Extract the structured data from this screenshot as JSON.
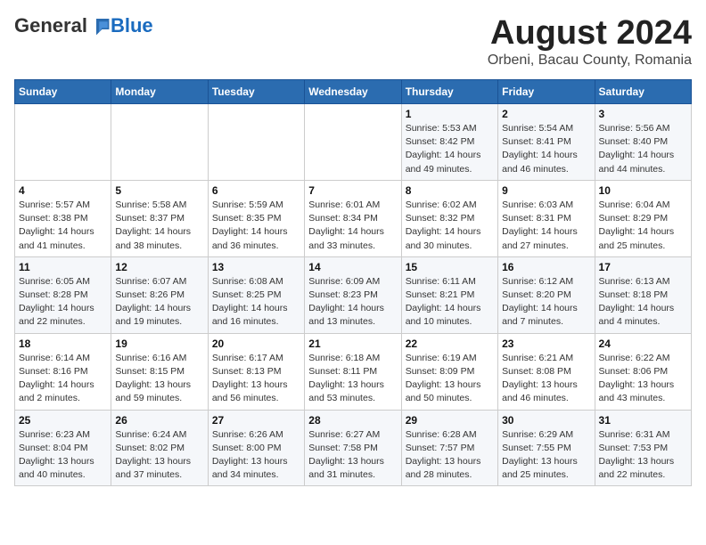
{
  "logo": {
    "general": "General",
    "blue": "Blue"
  },
  "title": {
    "month_year": "August 2024",
    "location": "Orbeni, Bacau County, Romania"
  },
  "weekdays": [
    "Sunday",
    "Monday",
    "Tuesday",
    "Wednesday",
    "Thursday",
    "Friday",
    "Saturday"
  ],
  "weeks": [
    [
      {
        "day": "",
        "info": ""
      },
      {
        "day": "",
        "info": ""
      },
      {
        "day": "",
        "info": ""
      },
      {
        "day": "",
        "info": ""
      },
      {
        "day": "1",
        "info": "Sunrise: 5:53 AM\nSunset: 8:42 PM\nDaylight: 14 hours\nand 49 minutes."
      },
      {
        "day": "2",
        "info": "Sunrise: 5:54 AM\nSunset: 8:41 PM\nDaylight: 14 hours\nand 46 minutes."
      },
      {
        "day": "3",
        "info": "Sunrise: 5:56 AM\nSunset: 8:40 PM\nDaylight: 14 hours\nand 44 minutes."
      }
    ],
    [
      {
        "day": "4",
        "info": "Sunrise: 5:57 AM\nSunset: 8:38 PM\nDaylight: 14 hours\nand 41 minutes."
      },
      {
        "day": "5",
        "info": "Sunrise: 5:58 AM\nSunset: 8:37 PM\nDaylight: 14 hours\nand 38 minutes."
      },
      {
        "day": "6",
        "info": "Sunrise: 5:59 AM\nSunset: 8:35 PM\nDaylight: 14 hours\nand 36 minutes."
      },
      {
        "day": "7",
        "info": "Sunrise: 6:01 AM\nSunset: 8:34 PM\nDaylight: 14 hours\nand 33 minutes."
      },
      {
        "day": "8",
        "info": "Sunrise: 6:02 AM\nSunset: 8:32 PM\nDaylight: 14 hours\nand 30 minutes."
      },
      {
        "day": "9",
        "info": "Sunrise: 6:03 AM\nSunset: 8:31 PM\nDaylight: 14 hours\nand 27 minutes."
      },
      {
        "day": "10",
        "info": "Sunrise: 6:04 AM\nSunset: 8:29 PM\nDaylight: 14 hours\nand 25 minutes."
      }
    ],
    [
      {
        "day": "11",
        "info": "Sunrise: 6:05 AM\nSunset: 8:28 PM\nDaylight: 14 hours\nand 22 minutes."
      },
      {
        "day": "12",
        "info": "Sunrise: 6:07 AM\nSunset: 8:26 PM\nDaylight: 14 hours\nand 19 minutes."
      },
      {
        "day": "13",
        "info": "Sunrise: 6:08 AM\nSunset: 8:25 PM\nDaylight: 14 hours\nand 16 minutes."
      },
      {
        "day": "14",
        "info": "Sunrise: 6:09 AM\nSunset: 8:23 PM\nDaylight: 14 hours\nand 13 minutes."
      },
      {
        "day": "15",
        "info": "Sunrise: 6:11 AM\nSunset: 8:21 PM\nDaylight: 14 hours\nand 10 minutes."
      },
      {
        "day": "16",
        "info": "Sunrise: 6:12 AM\nSunset: 8:20 PM\nDaylight: 14 hours\nand 7 minutes."
      },
      {
        "day": "17",
        "info": "Sunrise: 6:13 AM\nSunset: 8:18 PM\nDaylight: 14 hours\nand 4 minutes."
      }
    ],
    [
      {
        "day": "18",
        "info": "Sunrise: 6:14 AM\nSunset: 8:16 PM\nDaylight: 14 hours\nand 2 minutes."
      },
      {
        "day": "19",
        "info": "Sunrise: 6:16 AM\nSunset: 8:15 PM\nDaylight: 13 hours\nand 59 minutes."
      },
      {
        "day": "20",
        "info": "Sunrise: 6:17 AM\nSunset: 8:13 PM\nDaylight: 13 hours\nand 56 minutes."
      },
      {
        "day": "21",
        "info": "Sunrise: 6:18 AM\nSunset: 8:11 PM\nDaylight: 13 hours\nand 53 minutes."
      },
      {
        "day": "22",
        "info": "Sunrise: 6:19 AM\nSunset: 8:09 PM\nDaylight: 13 hours\nand 50 minutes."
      },
      {
        "day": "23",
        "info": "Sunrise: 6:21 AM\nSunset: 8:08 PM\nDaylight: 13 hours\nand 46 minutes."
      },
      {
        "day": "24",
        "info": "Sunrise: 6:22 AM\nSunset: 8:06 PM\nDaylight: 13 hours\nand 43 minutes."
      }
    ],
    [
      {
        "day": "25",
        "info": "Sunrise: 6:23 AM\nSunset: 8:04 PM\nDaylight: 13 hours\nand 40 minutes."
      },
      {
        "day": "26",
        "info": "Sunrise: 6:24 AM\nSunset: 8:02 PM\nDaylight: 13 hours\nand 37 minutes."
      },
      {
        "day": "27",
        "info": "Sunrise: 6:26 AM\nSunset: 8:00 PM\nDaylight: 13 hours\nand 34 minutes."
      },
      {
        "day": "28",
        "info": "Sunrise: 6:27 AM\nSunset: 7:58 PM\nDaylight: 13 hours\nand 31 minutes."
      },
      {
        "day": "29",
        "info": "Sunrise: 6:28 AM\nSunset: 7:57 PM\nDaylight: 13 hours\nand 28 minutes."
      },
      {
        "day": "30",
        "info": "Sunrise: 6:29 AM\nSunset: 7:55 PM\nDaylight: 13 hours\nand 25 minutes."
      },
      {
        "day": "31",
        "info": "Sunrise: 6:31 AM\nSunset: 7:53 PM\nDaylight: 13 hours\nand 22 minutes."
      }
    ]
  ]
}
